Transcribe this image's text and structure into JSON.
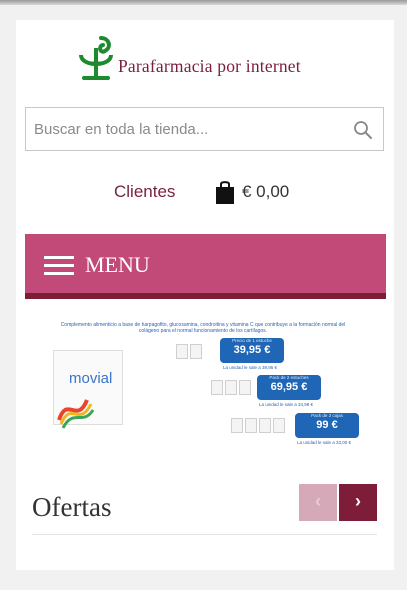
{
  "logo": {
    "text": "Parafarmacia por internet"
  },
  "search": {
    "placeholder": "Buscar en toda la tienda..."
  },
  "header": {
    "clients_label": "Clientes",
    "cart_total": "€ 0,00"
  },
  "menu": {
    "label": "MENU"
  },
  "banner": {
    "headline": "Complemento alimenticio a base de harpagofito, glucosamina, condroitina y vitamina C que contribuye a la formación normal del colágeno para el normal funcionamiento de los cartílagos.",
    "product_name": "movial",
    "offers": [
      {
        "label": "Precio de 1 estuche",
        "price": "39,95 €",
        "unit": "La unidad le sale a 39,95 €"
      },
      {
        "label": "Pack de 2 estuches",
        "price": "69,95 €",
        "unit": "La unidad le sale a 34,98 €"
      },
      {
        "label": "Pack de 3 cajas",
        "price": "99 €",
        "unit": "La unidad le sale a 33,00 €"
      }
    ]
  },
  "offers_section": {
    "title": "Ofertas",
    "prev": "‹",
    "next": "›"
  },
  "colors": {
    "brand": "#7a1f3c",
    "menu_bg": "#c24a78",
    "menu_border": "#7a1d35",
    "logo_green": "#1e8a2e"
  }
}
